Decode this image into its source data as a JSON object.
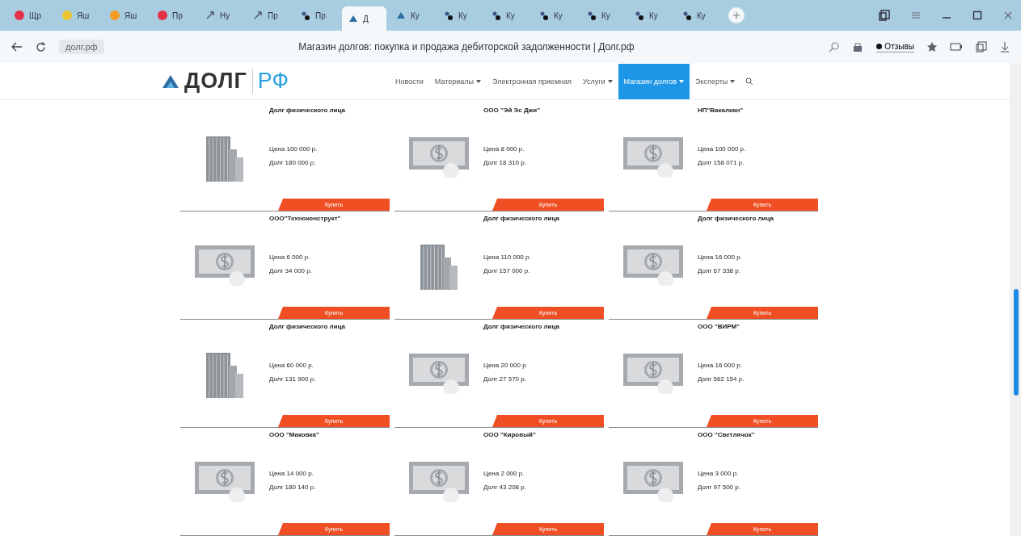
{
  "browser": {
    "tabs": [
      {
        "title": "Щр",
        "selected": false,
        "kind": "red"
      },
      {
        "title": "Яш",
        "selected": false,
        "kind": "yellow"
      },
      {
        "title": "Яш",
        "selected": false,
        "kind": "orange"
      },
      {
        "title": "Пр",
        "selected": false,
        "kind": "red"
      },
      {
        "title": "Ну",
        "selected": false,
        "kind": "link"
      },
      {
        "title": "Пр",
        "selected": false,
        "kind": "link"
      },
      {
        "title": "Пр",
        "selected": false,
        "kind": "dots"
      },
      {
        "title": "Д",
        "selected": true,
        "kind": "logo"
      },
      {
        "title": "Ку",
        "selected": false,
        "kind": "logo"
      },
      {
        "title": "Ку",
        "selected": false,
        "kind": "dots"
      },
      {
        "title": "Ку",
        "selected": false,
        "kind": "dots"
      },
      {
        "title": "Ку",
        "selected": false,
        "kind": "dots"
      },
      {
        "title": "Ку",
        "selected": false,
        "kind": "dots"
      },
      {
        "title": "Ку",
        "selected": false,
        "kind": "dots"
      },
      {
        "title": "Ку",
        "selected": false,
        "kind": "dots"
      }
    ],
    "address": "долг.рф",
    "page_title": "Магазин долгов: покупка и продажа дебиторской задолженности | Долг.рф",
    "reviews_button": "Отзывы"
  },
  "site": {
    "logo_main": "ДОЛГ",
    "logo_accent": "РФ",
    "nav": [
      {
        "label": "Новости",
        "dropdown": false,
        "selected": false
      },
      {
        "label": "Материалы",
        "dropdown": true,
        "selected": false
      },
      {
        "label": "Электронная приемная",
        "dropdown": false,
        "selected": false
      },
      {
        "label": "Услуги",
        "dropdown": true,
        "selected": false
      },
      {
        "label": "Магазин долгов",
        "dropdown": true,
        "selected": true
      },
      {
        "label": "Эксперты",
        "dropdown": true,
        "selected": false
      }
    ]
  },
  "lots": [
    {
      "kind": "person",
      "title": "Долг физического лица",
      "price": "Цена 100 000 р.",
      "debt": "Долг 180 000 р.",
      "button": "Купить"
    },
    {
      "kind": "company",
      "title": "ООО \"Эй Эс Джи\"",
      "price": "Цена 8 000 р.",
      "debt": "Долг 18 310 р.",
      "button": "Купить"
    },
    {
      "kind": "company",
      "title": "НП\"Вакалкан\"",
      "price": "Цена 100 000 р.",
      "debt": "Долг 158 071 р.",
      "button": "Купить"
    },
    {
      "kind": "company",
      "title": "ООО\"Техноконструкт\"",
      "price": "Цена 6 000 р.",
      "debt": "Долг 34 000 р.",
      "button": "Купить"
    },
    {
      "kind": "person",
      "title": "Долг физического лица",
      "price": "Цена 110 000 р.",
      "debt": "Долг 157 000 р.",
      "button": "Купить"
    },
    {
      "kind": "company",
      "title": "Долг физического лица",
      "price": "Цена 16 000 р.",
      "debt": "Долг 67 338 р.",
      "button": "Купить"
    },
    {
      "kind": "person",
      "title": "Долг физического лица",
      "price": "Цена 60 000 р.",
      "debt": "Долг 131 900 р.",
      "button": "Купить"
    },
    {
      "kind": "company",
      "title": "Долг физического лица",
      "price": "Цена 20 000 р.",
      "debt": "Долг 27 570 р.",
      "button": "Купить"
    },
    {
      "kind": "company",
      "title": "ООО \"ВИРМ\"",
      "price": "Цена 16 000 р.",
      "debt": "Долг 562 154 р.",
      "button": "Купить"
    },
    {
      "kind": "company",
      "title": "ООО \"Маковка\"",
      "price": "Цена 14 000 р.",
      "debt": "Долг 180 140 р.",
      "button": "Купить"
    },
    {
      "kind": "company",
      "title": "ООО \"Кировый\"",
      "price": "Цена 2 000 р.",
      "debt": "Долг 43 208 р.",
      "button": "Купить"
    },
    {
      "kind": "company",
      "title": "ООО \"Светлячок\"",
      "price": "Цена 3 000 р.",
      "debt": "Долг 97 500 р.",
      "button": "Купить"
    }
  ]
}
